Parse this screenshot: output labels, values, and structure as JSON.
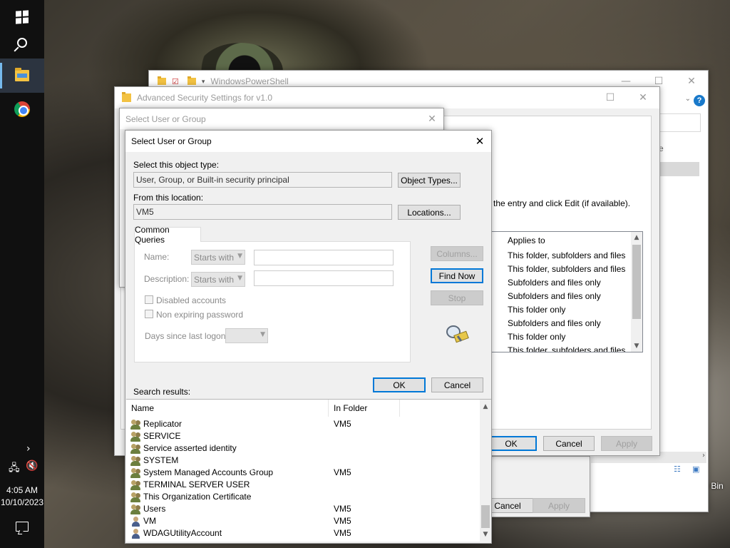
{
  "desktop": {
    "recycle_bin_label": "Recycle Bin"
  },
  "taskbar": {
    "time": "4:05 AM",
    "date": "10/10/2023",
    "icons": [
      "windows-start-icon",
      "search-icon",
      "file-explorer-icon",
      "chrome-icon"
    ]
  },
  "explorer_window": {
    "title": "WindowsPowerShell"
  },
  "advanced_security": {
    "title": "Advanced Security Settings for v1.0",
    "instruction_fragment": "the entry and click Edit (if available).",
    "applies_to_header": "Applies to",
    "applies_to_rows": [
      "This folder, subfolders and files",
      "This folder, subfolders and files",
      "Subfolders and files only",
      "Subfolders and files only",
      "This folder only",
      "Subfolders and files only",
      "This folder only",
      "This folder, subfolders and files"
    ],
    "ok": "OK",
    "cancel": "Cancel",
    "apply": "Apply",
    "back_cancel": "Cancel",
    "back_apply": "Apply",
    "back_partial_e": "e"
  },
  "select_back": {
    "title": "Select User or Group"
  },
  "select_dialog": {
    "title": "Select User or Group",
    "object_type_label": "Select this object type:",
    "object_type_value": "User, Group, or Built-in security principal",
    "object_types_button": "Object Types...",
    "location_label": "From this location:",
    "location_value": "VM5",
    "locations_button": "Locations...",
    "tab_common_queries": "Common Queries",
    "name_label": "Name:",
    "name_mode": "Starts with",
    "description_label": "Description:",
    "description_mode": "Starts with",
    "disabled_accounts": "Disabled accounts",
    "non_expiring_password": "Non expiring password",
    "days_since_logon": "Days since last logon:",
    "columns_button": "Columns...",
    "find_now_button": "Find Now",
    "stop_button": "Stop",
    "ok": "OK",
    "cancel": "Cancel",
    "search_results_label": "Search results:",
    "col_name": "Name",
    "col_folder": "In Folder",
    "results": [
      {
        "name": "Replicator",
        "folder": "VM5",
        "icon": "group-icon"
      },
      {
        "name": "SERVICE",
        "folder": "",
        "icon": "group-icon"
      },
      {
        "name": "Service asserted identity",
        "folder": "",
        "icon": "group-icon"
      },
      {
        "name": "SYSTEM",
        "folder": "",
        "icon": "group-icon"
      },
      {
        "name": "System Managed Accounts Group",
        "folder": "VM5",
        "icon": "group-icon"
      },
      {
        "name": "TERMINAL SERVER USER",
        "folder": "",
        "icon": "group-icon"
      },
      {
        "name": "This Organization Certificate",
        "folder": "",
        "icon": "group-icon"
      },
      {
        "name": "Users",
        "folder": "VM5",
        "icon": "group-icon"
      },
      {
        "name": "VM",
        "folder": "VM5",
        "icon": "user-icon"
      },
      {
        "name": "WDAGUtilityAccount",
        "folder": "VM5",
        "icon": "user-icon"
      }
    ]
  }
}
